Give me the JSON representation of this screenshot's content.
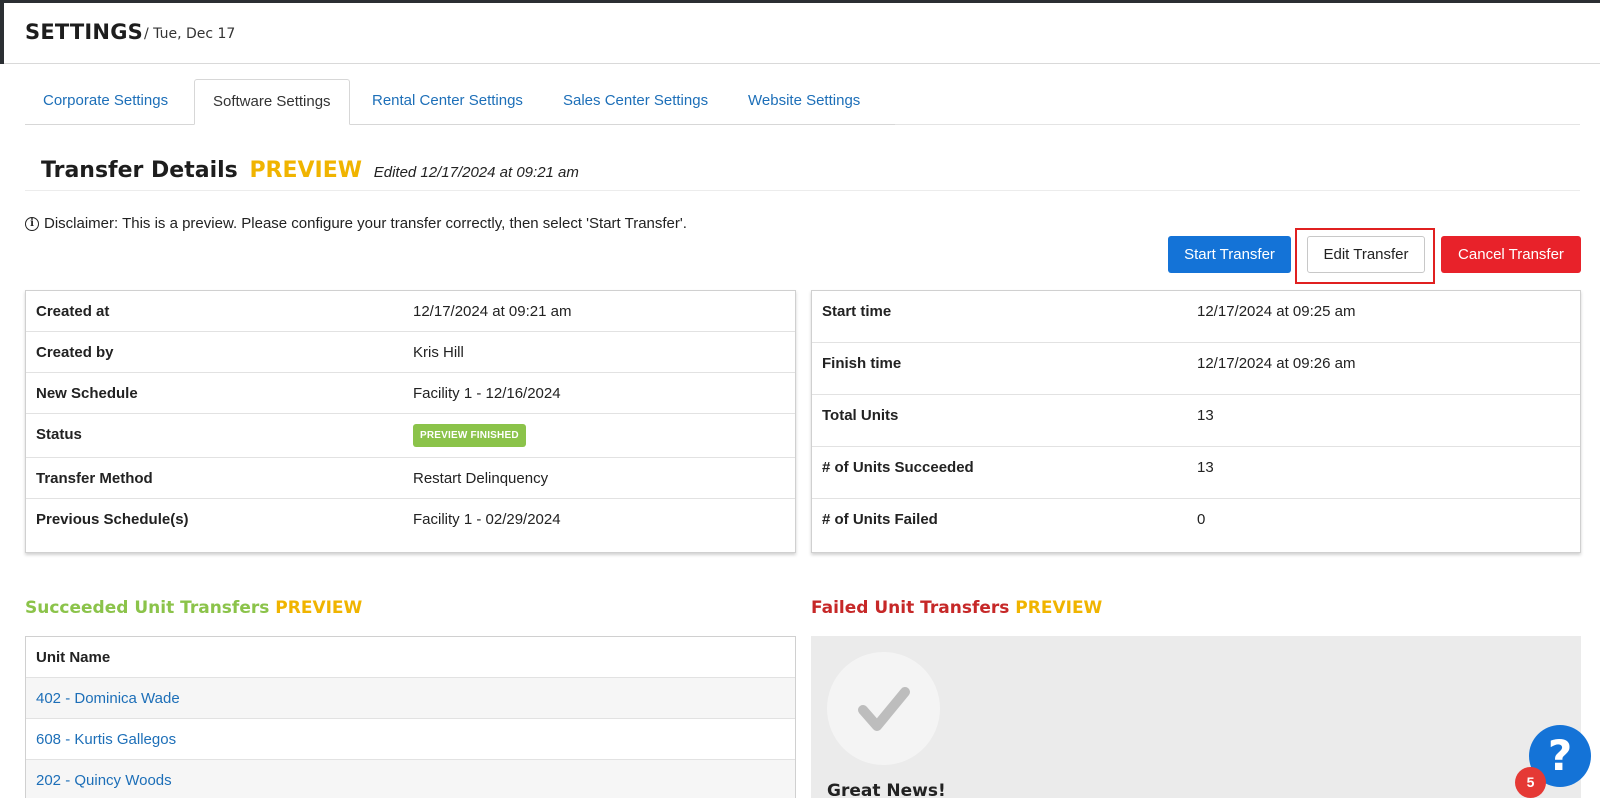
{
  "header": {
    "title": "SETTINGS",
    "date": "/ Tue, Dec 17"
  },
  "tabs": [
    {
      "label": "Corporate Settings",
      "active": false
    },
    {
      "label": "Software Settings",
      "active": true
    },
    {
      "label": "Rental Center Settings",
      "active": false
    },
    {
      "label": "Sales Center Settings",
      "active": false
    },
    {
      "label": "Website Settings",
      "active": false
    }
  ],
  "transfer": {
    "title": "Transfer Details",
    "preview_label": "PREVIEW",
    "edited": "Edited 12/17/2024 at 09:21 am",
    "disclaimer": "Disclaimer: This is a preview. Please configure your transfer correctly, then select 'Start Transfer'."
  },
  "actions": {
    "start": "Start Transfer",
    "edit": "Edit Transfer",
    "cancel": "Cancel Transfer"
  },
  "details_left": [
    {
      "key": "Created at",
      "value": "12/17/2024 at 09:21 am"
    },
    {
      "key": "Created by",
      "value": "Kris Hill"
    },
    {
      "key": "New Schedule",
      "value": "Facility 1 - 12/16/2024"
    },
    {
      "key": "Status",
      "value": "PREVIEW FINISHED"
    },
    {
      "key": "Transfer Method",
      "value": "Restart Delinquency"
    },
    {
      "key": "Previous Schedule(s)",
      "value": "Facility 1 - 02/29/2024"
    }
  ],
  "details_right": [
    {
      "key": "Start time",
      "value": "12/17/2024 at 09:25 am"
    },
    {
      "key": "Finish time",
      "value": "12/17/2024 at 09:26 am"
    },
    {
      "key": "Total Units",
      "value": "13"
    },
    {
      "key": "# of Units Succeeded",
      "value": "13"
    },
    {
      "key": "# of Units Failed",
      "value": "0"
    }
  ],
  "succeeded": {
    "title": "Succeeded Unit Transfers",
    "preview_label": "PREVIEW",
    "column": "Unit Name",
    "rows": [
      "402 - Dominica Wade",
      "608 - Kurtis Gallegos",
      "202 - Quincy Woods"
    ]
  },
  "failed": {
    "title": "Failed Unit Transfers",
    "preview_label": "PREVIEW",
    "message": "Great News!"
  },
  "help": {
    "icon": "question-icon",
    "glyph": "?",
    "badge_count": "5"
  },
  "colors": {
    "primary": "#1473d7",
    "danger": "#e8222a",
    "preview": "#f0b400",
    "success": "#8bc34a",
    "fail_title": "#c62828",
    "link": "#1d6fb8"
  }
}
